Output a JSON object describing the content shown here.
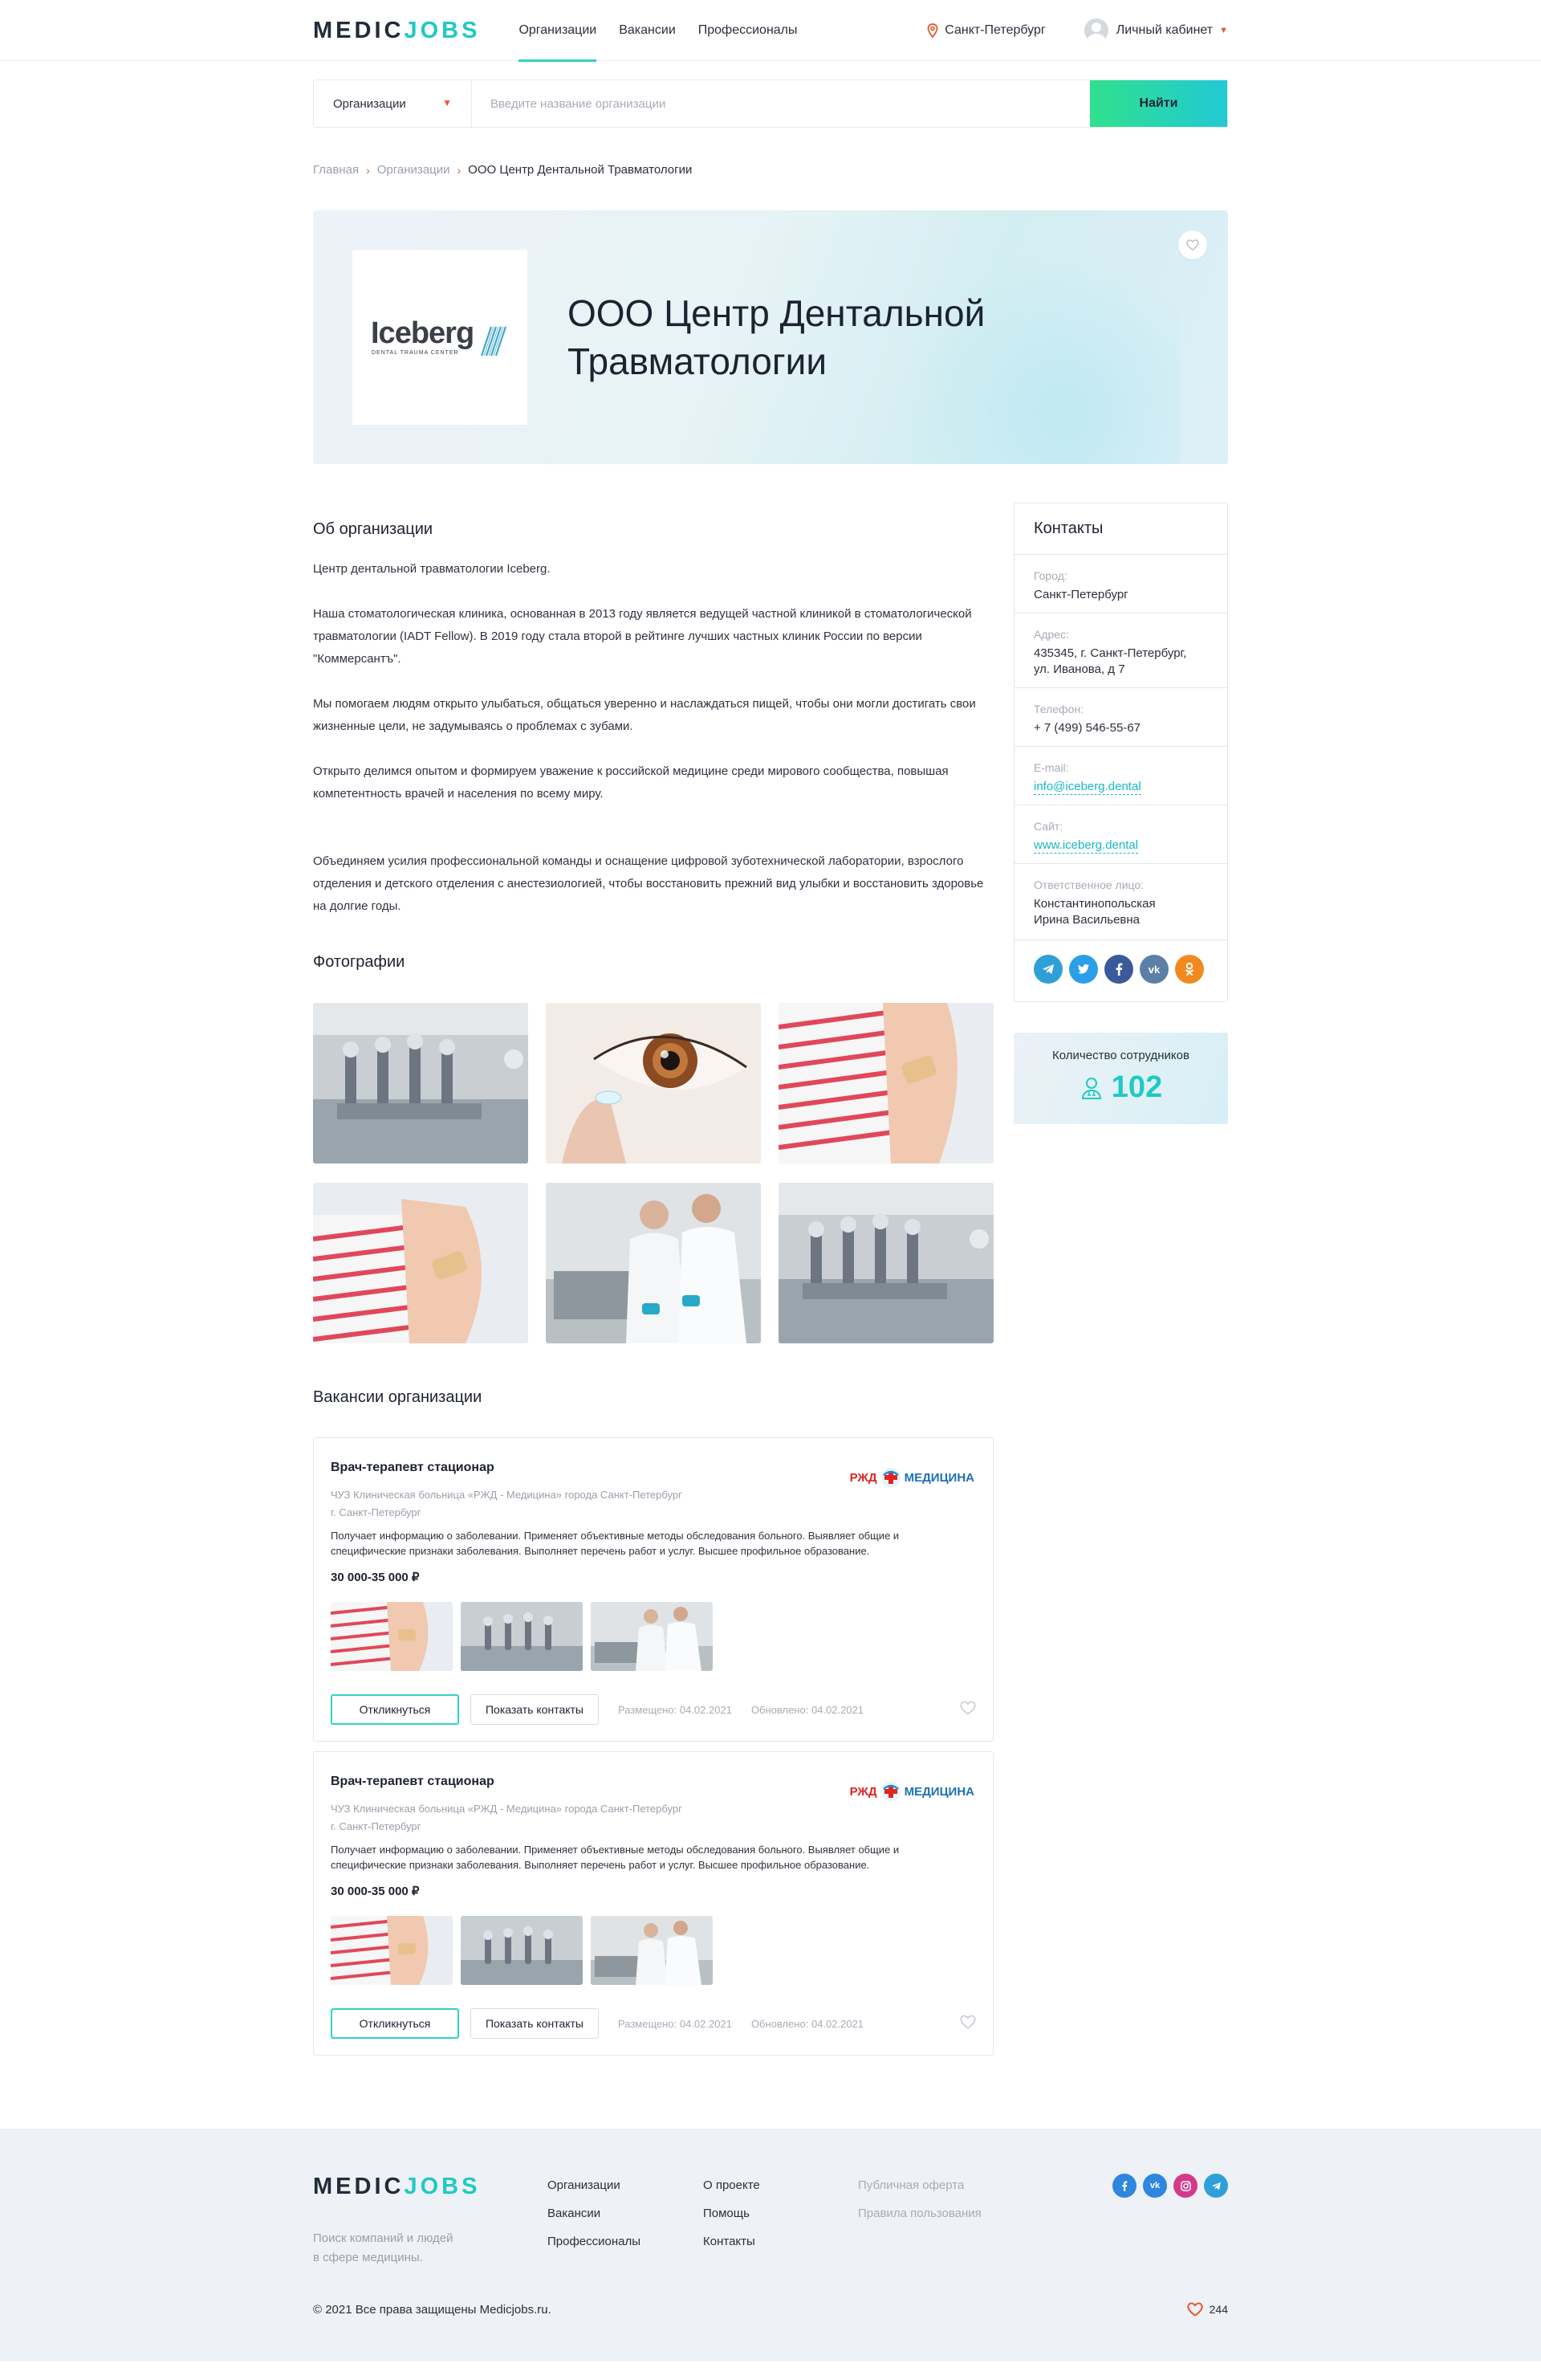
{
  "header": {
    "logo_medic": "MEDIC",
    "logo_jobs": "JOBS",
    "nav": [
      "Организации",
      "Вакансии",
      "Профессионалы"
    ],
    "active_nav": "Организации",
    "city": "Санкт-Петербург",
    "account_label": "Личный кабинет"
  },
  "search": {
    "select_value": "Организации",
    "placeholder": "Введите название организации",
    "button_label": "Найти"
  },
  "breadcrumb": {
    "home": "Главная",
    "section": "Организации",
    "current": "ООО Центр Дентальной Травматологии"
  },
  "hero": {
    "logo_word": "Iceberg",
    "logo_tagline": "DENTAL TRAUMA CENTER",
    "title": "ООО Центр Дентальной Травматологии"
  },
  "about": {
    "heading": "Об организации",
    "p1": "Центр дентальной травматологии Iceberg.",
    "p2": "Наша стоматологическая клиника, основанная в 2013 году является ведущей частной клиникой в стоматологической травматологии (IADT Fellow). В 2019 году стала второй в рейтинге лучших частных клиник России по версии \"Коммерсантъ\".",
    "p3": "Мы помогаем людям открыто улыбаться, общаться уверенно и наслаждаться пищей, чтобы они могли достигать свои жизненные цели, не задумываясь о проблемах с зубами.",
    "p4": "Открыто делимся опытом и формируем уважение к российской медицине среди мирового сообщества, повышая компетентность врачей и населения по всему миру.",
    "p5": "Объединяем усилия профессиональной команды и оснащение  цифровой зуботехнической лаборатории, взрослого отделения и детского отделения с анестезиологией, чтобы восстановить прежний вид улыбки и восстановить здоровье на долгие годы."
  },
  "photos": {
    "heading": "Фотографии",
    "items": [
      "surgical-robot",
      "eye-contact-lens",
      "child-arm-bandage",
      "child-arm-bandage",
      "lab-scientists",
      "surgical-robot"
    ]
  },
  "vacancies": {
    "heading": "Вакансии организации",
    "items": [
      {
        "title": "Врач-терапевт стационар",
        "org": "ЧУЗ Клиническая больница «РЖД - Медицина» города Санкт-Петербург",
        "city": "г. Санкт-Петербург",
        "description": "Получает информацию о заболевании. Применяет объективные методы обследования больного. Выявляет общие и специфические признаки заболевания. Выполняет перечень работ и услуг. Высшее профильное образование.",
        "salary": "30 000-35 000 ₽",
        "brand_left": "РЖД",
        "brand_right": "МЕДИЦИНА",
        "respond_label": "Откликнуться",
        "contacts_label": "Показать контакты",
        "posted": "Размещено: 04.02.2021",
        "updated": "Обновлено: 04.02.2021"
      },
      {
        "title": "Врач-терапевт стационар",
        "org": "ЧУЗ Клиническая больница «РЖД - Медицина» города Санкт-Петербург",
        "city": "г. Санкт-Петербург",
        "description": "Получает информацию о заболевании. Применяет объективные методы обследования больного. Выявляет общие и специфические признаки заболевания. Выполняет перечень работ и услуг. Высшее профильное образование.",
        "salary": "30 000-35 000 ₽",
        "brand_left": "РЖД",
        "brand_right": "МЕДИЦИНА",
        "respond_label": "Откликнуться",
        "contacts_label": "Показать контакты",
        "posted": "Размещено: 04.02.2021",
        "updated": "Обновлено: 04.02.2021"
      }
    ]
  },
  "contacts": {
    "heading": "Контакты",
    "city_label": "Город:",
    "city": "Санкт-Петербург",
    "address_label": "Адрес:",
    "address_line1": "435345, г. Санкт-Петербург,",
    "address_line2": "ул. Иванова, д 7",
    "phone_label": "Телефон:",
    "phone": "+ 7 (499) 546-55-67",
    "email_label": "E-mail:",
    "email": "info@iceberg.dental",
    "site_label": "Сайт:",
    "site": "www.iceberg.dental",
    "person_label": "Ответственное лицо:",
    "person_line1": "Константинопольская",
    "person_line2": "Ирина Васильевна",
    "socials": [
      "telegram",
      "twitter",
      "facebook",
      "vk",
      "odnoklassniki"
    ]
  },
  "employees": {
    "label": "Количество сотрудников",
    "count": "102"
  },
  "footer": {
    "tagline_line1": "Поиск компаний и людей",
    "tagline_line2": "в сфере медицины.",
    "col1": [
      "Организации",
      "Вакансии",
      "Профессионалы"
    ],
    "col2": [
      "О проекте",
      "Помощь",
      "Контакты"
    ],
    "col3": [
      "Публичная оферта",
      "Правила пользования"
    ],
    "socials": [
      "facebook",
      "vk",
      "instagram",
      "telegram"
    ],
    "copyright": "© 2021 Все права защищены Medicjobs.ru.",
    "likes": "244"
  },
  "colors": {
    "accent": "#2ed3c3",
    "accent_text": "#1fc9c4",
    "orange": "#e8572f",
    "link": "#19b7c6"
  }
}
